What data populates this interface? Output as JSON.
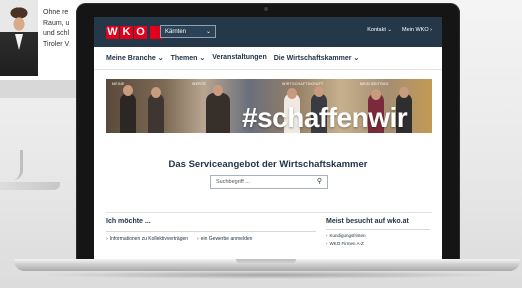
{
  "background_article": {
    "lines": [
      "Ohne re",
      "Raum, u",
      "und schl",
      "Tiroler V"
    ]
  },
  "header": {
    "region_select": "Kärnten",
    "top_links": [
      "Kontakt",
      "Mein WKO"
    ]
  },
  "nav": {
    "items": [
      "Meine Branche",
      "Themen",
      "Veranstaltungen",
      "Die Wirtschaftskammer"
    ]
  },
  "hero": {
    "hashtag": "#schaffenwir",
    "panel_labels": [
      "MEINE",
      "WERTE",
      "WIRTSCHAFTSKRAFT",
      "MEIN BEITRAG"
    ]
  },
  "service": {
    "title": "Das Serviceangebot der Wirtschaftskammer",
    "search_placeholder": "Suchbegriff ..."
  },
  "ich_moechte": {
    "title": "Ich möchte ...",
    "links": [
      "Informationen zu Kollektivverträgen",
      "ein Gewerbe anmelden"
    ]
  },
  "meist_besucht": {
    "title": "Meist besucht auf wko.at",
    "items": [
      "Kundigungsfristen",
      "WKO Firmen A-Z"
    ]
  },
  "colors": {
    "header_bg": "#25384a",
    "brand_red": "#e3001b",
    "text_dark": "#233548"
  },
  "icons": [
    "chevron-down-icon",
    "search-icon",
    "arrow-right-icon"
  ]
}
